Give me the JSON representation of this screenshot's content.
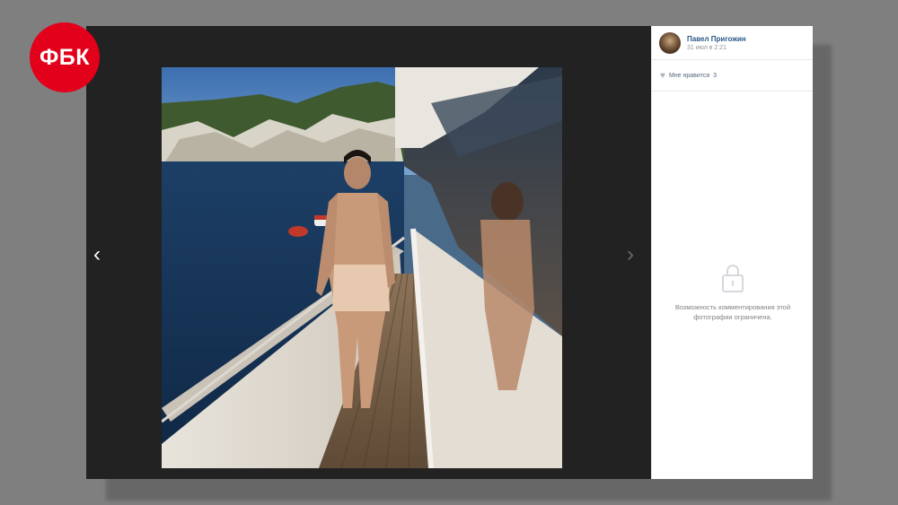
{
  "logo": {
    "text": "ФБК",
    "color": "#e3001b"
  },
  "viewer": {
    "prev_icon": "chevron-left-icon",
    "next_icon": "chevron-right-icon",
    "prev_label": "‹",
    "next_label": "›"
  },
  "post": {
    "author_name": "Павел Пригожин",
    "date": "31 июл в 2:21",
    "likes_label": "Мне нравится",
    "likes_count": "3",
    "comments_locked_text": "Возможность комментирования этой фотографии ограничена.",
    "link_color": "#2a5885"
  }
}
